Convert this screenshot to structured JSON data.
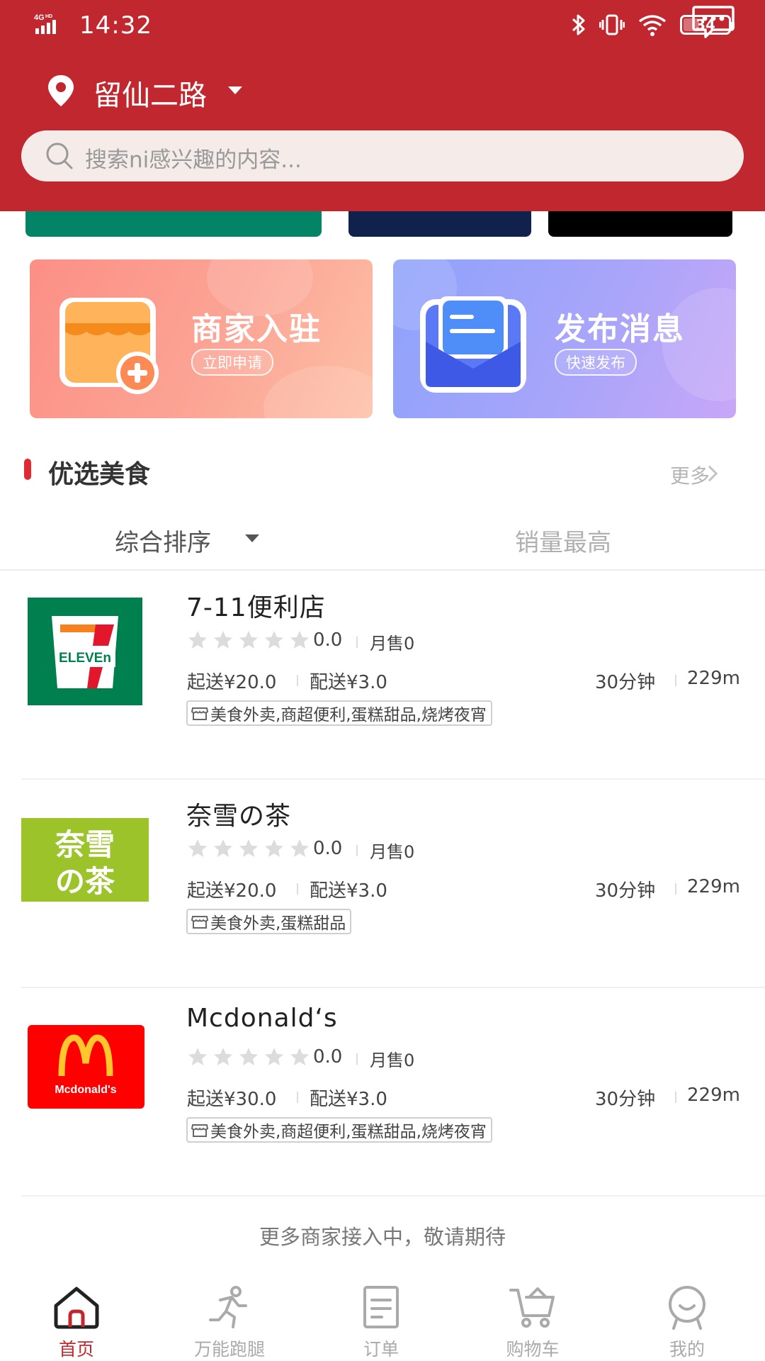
{
  "status_bar": {
    "network": "4G",
    "network_sup": "HD",
    "time": "14:32",
    "battery": "34",
    "battery_level": 0.34
  },
  "header": {
    "location": "留仙二路",
    "search_placeholder": "搜索ni感兴趣的内容..."
  },
  "banner_colors": [
    "#048466",
    "#10214b",
    "#000000"
  ],
  "promo": [
    {
      "title": "商家入驻",
      "button": "立即申请",
      "color": "#fc8f86"
    },
    {
      "title": "发布消息",
      "button": "快速发布",
      "color": "#8ea2fb"
    }
  ],
  "section": {
    "title": "优选美食",
    "more": "更多"
  },
  "sort_tabs": [
    "综合排序",
    "销量最高"
  ],
  "shops": [
    {
      "name": "7-11便利店",
      "logo": {
        "type": "7-eleven",
        "text": "ELEVEn",
        "bg": "#00804f"
      },
      "rating": "0.0",
      "stars": 0,
      "monthly_sales": "月售0",
      "min_order": "起送¥20.0",
      "delivery_fee": "配送¥3.0",
      "time": "30分钟",
      "distance": "229m",
      "tags": "美食外卖,商超便利,蛋糕甜品,烧烤夜宵"
    },
    {
      "name": "奈雪の茶",
      "logo": {
        "type": "nayuki",
        "text_line1": "奈雪",
        "text_line2": "の茶",
        "bg": "#9cc42a"
      },
      "rating": "0.0",
      "stars": 0,
      "monthly_sales": "月售0",
      "min_order": "起送¥20.0",
      "delivery_fee": "配送¥3.0",
      "time": "30分钟",
      "distance": "229m",
      "tags": "美食外卖,蛋糕甜品"
    },
    {
      "name": "Mcdonald‘s",
      "logo": {
        "type": "mcdonalds",
        "text": "Mcdonald's",
        "bg": "#ff0000"
      },
      "rating": "0.0",
      "stars": 0,
      "monthly_sales": "月售0",
      "min_order": "起送¥30.0",
      "delivery_fee": "配送¥3.0",
      "time": "30分钟",
      "distance": "229m",
      "tags": "美食外卖,商超便利,蛋糕甜品,烧烤夜宵"
    }
  ],
  "footer_note": "更多商家接入中，敬请期待",
  "bottom_nav": [
    {
      "label": "首页",
      "icon": "home-icon",
      "active": true
    },
    {
      "label": "万能跑腿",
      "icon": "runner-icon",
      "active": false
    },
    {
      "label": "订单",
      "icon": "order-icon",
      "active": false
    },
    {
      "label": "购物车",
      "icon": "cart-icon",
      "active": false
    },
    {
      "label": "我的",
      "icon": "profile-icon",
      "active": false
    }
  ],
  "colors": {
    "brand_red": "#c1272f",
    "accent_red": "#e02a33",
    "search_bg": "#f5ecea"
  }
}
